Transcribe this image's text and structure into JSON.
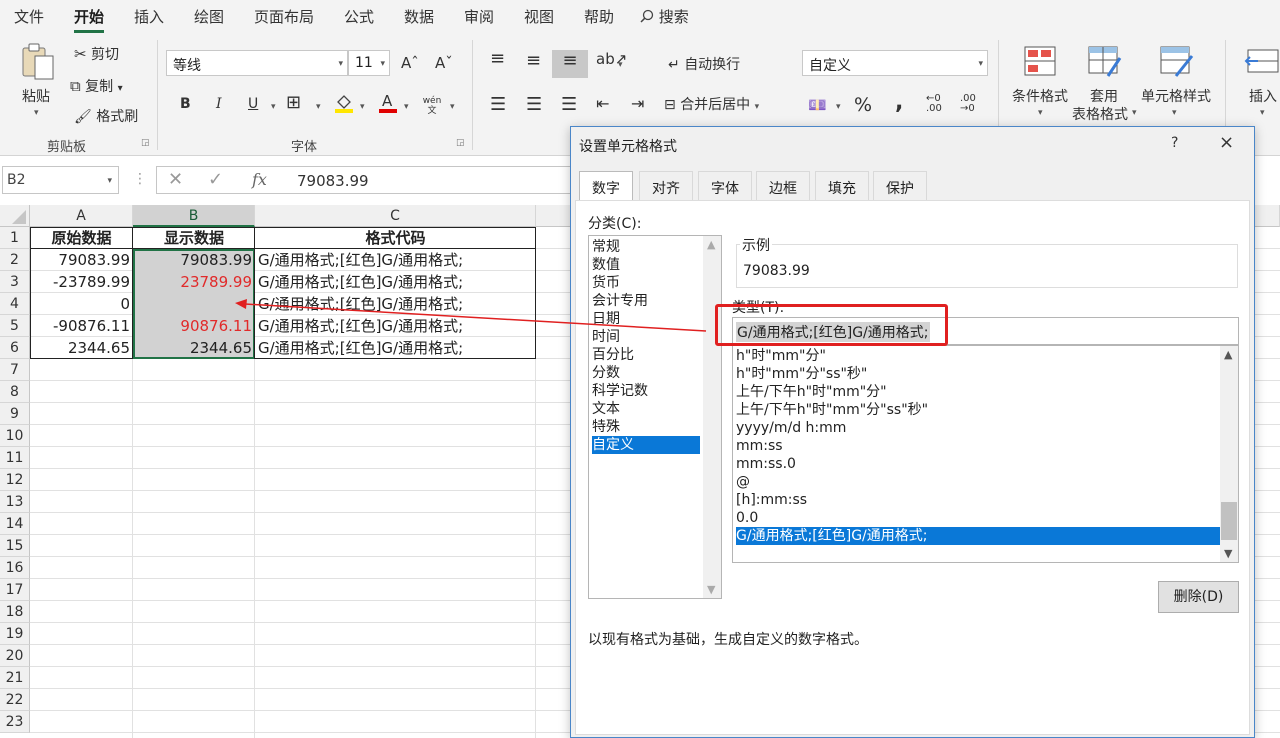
{
  "menu": {
    "tabs": [
      "文件",
      "开始",
      "插入",
      "绘图",
      "页面布局",
      "公式",
      "数据",
      "审阅",
      "视图",
      "帮助"
    ],
    "search": "搜索",
    "active_tab": "开始"
  },
  "ribbon": {
    "clipboard": {
      "paste": "粘贴",
      "cut": "剪切",
      "copy": "复制",
      "format_painter": "格式刷",
      "group": "剪贴板"
    },
    "font": {
      "font_name": "等线",
      "font_size": "11",
      "group": "字体",
      "bold": "B",
      "italic": "I",
      "underline": "U",
      "phonetic": "wén文"
    },
    "alignment": {
      "wrap": "自动换行",
      "merge": "合并后居中"
    },
    "number": {
      "format": "自定义",
      "percent": "%",
      "comma": ","
    },
    "styles": {
      "conditional": "条件格式",
      "table_top": "套用",
      "table_bottom": "表格格式",
      "cell_styles": "单元格样式"
    },
    "cells": {
      "insert": "插入"
    }
  },
  "formula_bar": {
    "name_box": "B2",
    "fx": "fx",
    "value": "79083.99"
  },
  "sheet": {
    "columns": [
      "A",
      "B",
      "C"
    ],
    "selected_column": "B",
    "headers": [
      "原始数据",
      "显示数据",
      "格式代码"
    ],
    "rows": [
      {
        "a": "79083.99",
        "b": "79083.99",
        "b_red": false,
        "c": "G/通用格式;[红色]G/通用格式;"
      },
      {
        "a": "-23789.99",
        "b": "23789.99",
        "b_red": true,
        "c": "G/通用格式;[红色]G/通用格式;"
      },
      {
        "a": "0",
        "b": "",
        "b_red": false,
        "c": "G/通用格式;[红色]G/通用格式;"
      },
      {
        "a": "-90876.11",
        "b": "90876.11",
        "b_red": true,
        "c": "G/通用格式;[红色]G/通用格式;"
      },
      {
        "a": "2344.65",
        "b": "2344.65",
        "b_red": false,
        "c": "G/通用格式;[红色]G/通用格式;"
      }
    ],
    "row_numbers": [
      "1",
      "2",
      "3",
      "4",
      "5",
      "6",
      "7",
      "8",
      "9",
      "10",
      "11",
      "12",
      "13",
      "14",
      "15",
      "16",
      "17",
      "18",
      "19",
      "20",
      "21",
      "22",
      "23"
    ]
  },
  "dialog": {
    "title": "设置单元格格式",
    "help": "?",
    "close": "×",
    "tabs": [
      "数字",
      "对齐",
      "字体",
      "边框",
      "填充",
      "保护"
    ],
    "active_tab": "数字",
    "category_label": "分类(C):",
    "categories": [
      "常规",
      "数值",
      "货币",
      "会计专用",
      "日期",
      "时间",
      "百分比",
      "分数",
      "科学记数",
      "文本",
      "特殊",
      "自定义"
    ],
    "selected_category": "自定义",
    "sample_label": "示例",
    "sample_value": "79083.99",
    "type_label": "类型(T):",
    "type_value": "G/通用格式;[红色]G/通用格式;",
    "type_list": [
      "h\"时\"mm\"分\"",
      "h\"时\"mm\"分\"ss\"秒\"",
      "上午/下午h\"时\"mm\"分\"",
      "上午/下午h\"时\"mm\"分\"ss\"秒\"",
      "yyyy/m/d h:mm",
      "mm:ss",
      "mm:ss.0",
      "@",
      "[h]:mm:ss",
      "0.0",
      "G/通用格式;[红色]G/通用格式;"
    ],
    "delete_button": "删除(D)",
    "description": "以现有格式为基础，生成自定义的数字格式。"
  },
  "colors": {
    "accent": "#217346",
    "selection": "#0a78d7",
    "annotation": "#e02020",
    "negative": "#e12a2a"
  }
}
